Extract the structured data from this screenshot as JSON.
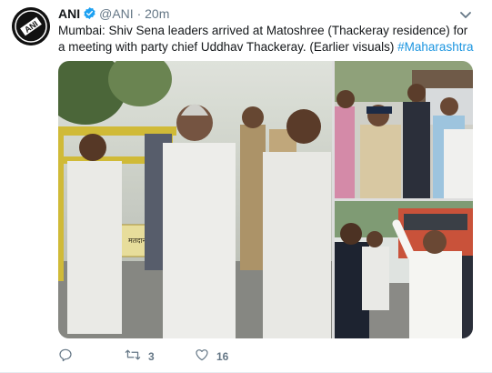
{
  "tweet": {
    "author_name": "ANI",
    "handle": "@ANI",
    "separator": "·",
    "time": "20m",
    "text_main": "Mumbai: Shiv Sena leaders arrived at Matoshree (Thackeray residence) for a meeting with party chief Uddhav Thackeray. (Earlier visuals) ",
    "hashtag": "#Maharashtra",
    "avatar_text": "ANI",
    "verified_color": "#1da1f2",
    "hashtag_color": "#1b95e0"
  },
  "actions": {
    "reply_count": "",
    "retweet_count": "3",
    "like_count": "16"
  },
  "media": {
    "main_banner_text": "मतदान",
    "icons": [
      "reply-icon",
      "retweet-icon",
      "like-icon",
      "caret-down-icon",
      "verified-badge-icon"
    ]
  }
}
